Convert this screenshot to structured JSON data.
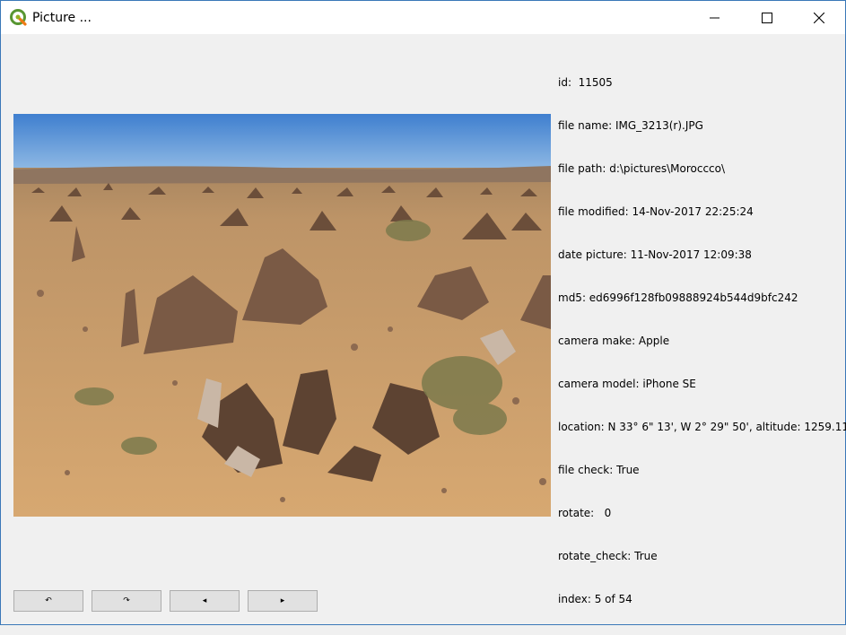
{
  "window": {
    "title": "Picture ..."
  },
  "info": {
    "lines": [
      "id:  11505",
      "file name: IMG_3213(r).JPG",
      "file path: d:\\pictures\\Moroccco\\",
      "file modified: 14-Nov-2017 22:25:24",
      "date picture: 11-Nov-2017 12:09:38",
      "md5: ed6996f128fb09888924b544d9bfc242",
      "camera make: Apple",
      "camera model: iPhone SE",
      "location: N 33° 6\" 13', W 2° 29\" 50', altitude: 1259.11",
      "file check: True",
      "rotate:   0",
      "rotate_check: True",
      "index: 5 of 54"
    ]
  },
  "toolbar": {
    "rotate_left_label": "↶",
    "rotate_right_label": "↷",
    "previous_label": "◂",
    "next_label": "▸"
  },
  "photo": {
    "icon": "photo-image"
  }
}
